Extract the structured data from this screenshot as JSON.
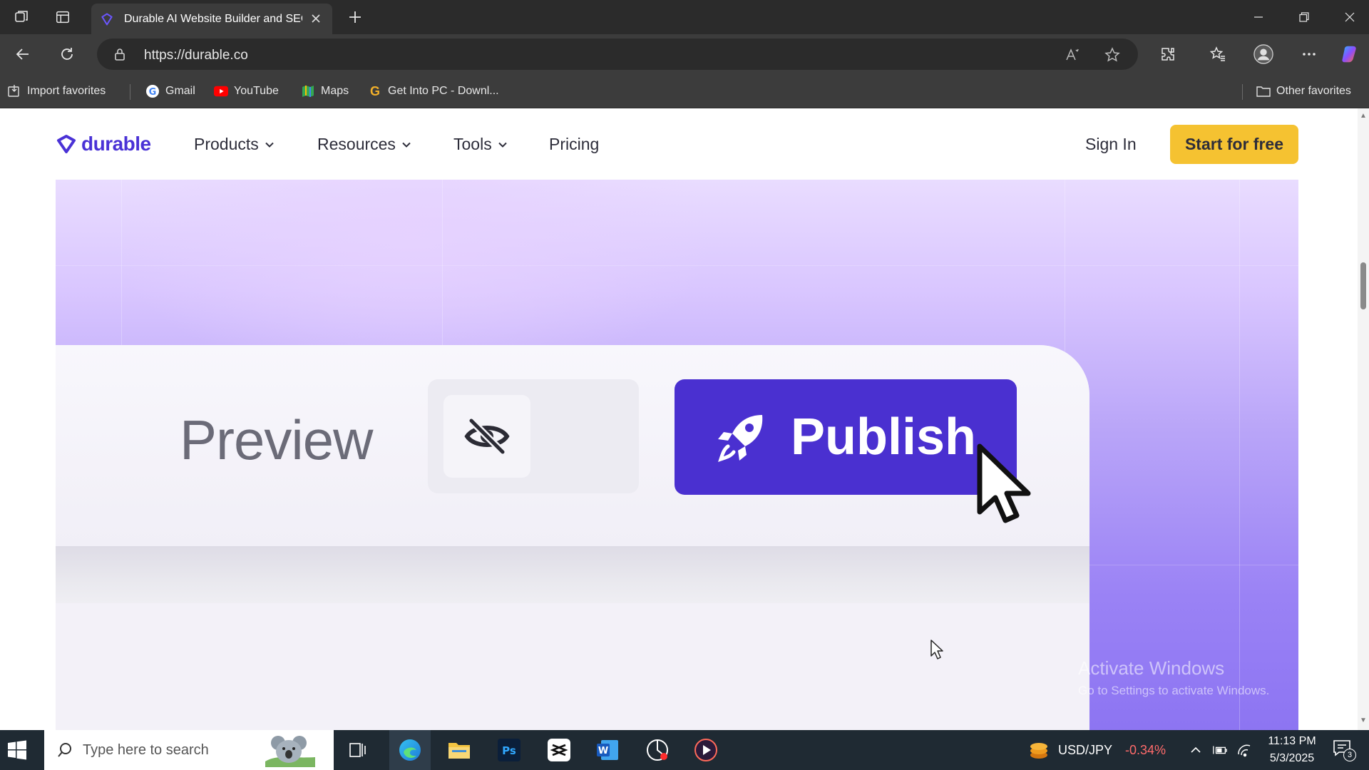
{
  "browser": {
    "tab_title": "Durable AI Website Builder and SEO",
    "url": "https://durable.co",
    "favorites": [
      {
        "label": "Import favorites",
        "icon": "import-icon"
      },
      {
        "label": "Gmail",
        "icon": "google-icon"
      },
      {
        "label": "YouTube",
        "icon": "youtube-icon"
      },
      {
        "label": "Maps",
        "icon": "maps-icon"
      },
      {
        "label": "Get Into PC - Downl...",
        "icon": "getintopc-icon"
      }
    ],
    "other_favorites": "Other favorites"
  },
  "site": {
    "logo_text": "durable",
    "nav": [
      {
        "label": "Products"
      },
      {
        "label": "Resources"
      },
      {
        "label": "Tools"
      },
      {
        "label": "Pricing"
      }
    ],
    "sign_in": "Sign In",
    "cta": "Start for free",
    "brand_color": "#4a30d0",
    "cta_color": "#f5c231"
  },
  "hero": {
    "preview_label": "Preview",
    "publish_label": "Publish"
  },
  "watermark": {
    "title": "Activate Windows",
    "subtitle": "Go to Settings to activate Windows."
  },
  "taskbar": {
    "search_placeholder": "Type here to search",
    "ticker_label": "USD/JPY",
    "ticker_change": "-0.34%",
    "time": "11:13 PM",
    "date": "5/3/2025",
    "notification_count": "3"
  }
}
